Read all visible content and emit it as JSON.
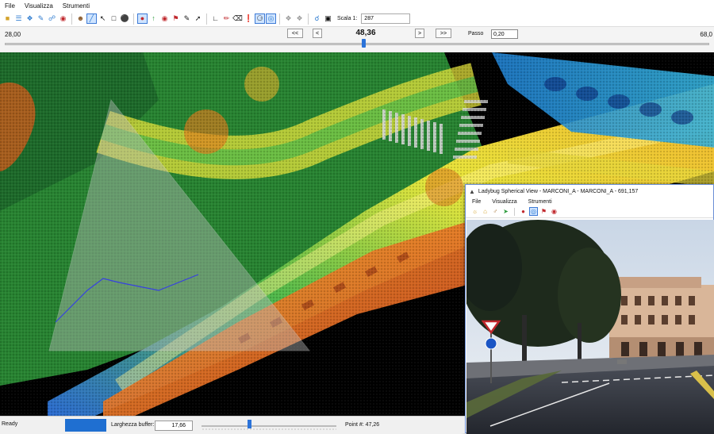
{
  "menu": [
    "File",
    "Visualizza",
    "Strumenti"
  ],
  "toolbar": {
    "scale_label": "Scala 1:",
    "scale_value": "287",
    "icons": [
      "open-folder-icon",
      "layers-icon",
      "tree-icon",
      "draw-icon",
      "link-icon",
      "record-icon",
      "measure-icon",
      "select-icon",
      "box-icon",
      "dot-icon",
      "active-camera-icon",
      "up-arrow-icon",
      "target-icon",
      "flag-icon",
      "pen-icon",
      "ruler-icon",
      "path-icon",
      "pin-icon",
      "user-icon",
      "point-icon",
      "sphere-icon",
      "compass-icon",
      "zoom-icon"
    ]
  },
  "timeline": {
    "min": "28,00",
    "max": "68,0",
    "current": "48,36",
    "buttons": [
      "<<",
      "<",
      ">",
      ">>"
    ],
    "step_label": "Passo",
    "step_value": "0,20",
    "progress_fraction": 0.51
  },
  "ladybug": {
    "title": "Ladybug Spherical View - MARCONI_A - MARCONI_A - 691,157",
    "menu": [
      "File",
      "Visualizza",
      "Strumenti"
    ]
  },
  "status": {
    "ready": "Ready",
    "buffer_label": "Larghezza buffer:",
    "buffer_value": "17,66",
    "point_label": "Point #: 47,26",
    "swatch_color": "#1f6fd1"
  }
}
